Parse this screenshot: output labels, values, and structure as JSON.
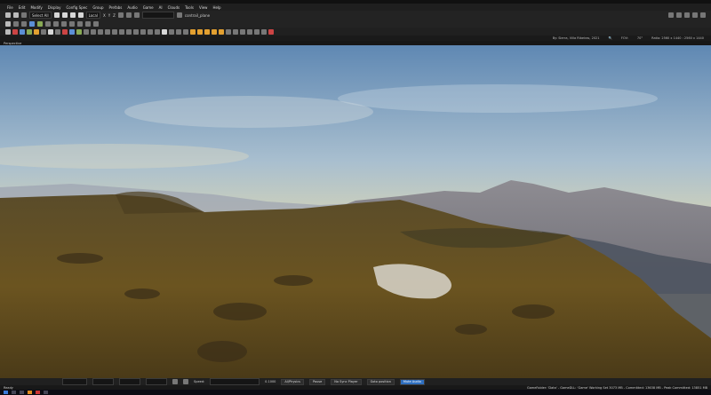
{
  "menu": [
    "File",
    "Edit",
    "Modify",
    "Display",
    "Config Spec",
    "Group",
    "Prefabs",
    "Audio",
    "Game",
    "AI",
    "Clouds",
    "Tools",
    "View",
    "Help"
  ],
  "toolbar": {
    "select_all": "Select All",
    "coord_space": "Local",
    "axis_x": "X",
    "axis_y": "Y",
    "axis_z": "Z",
    "object_name": "contrail_plane"
  },
  "infobar": {
    "location": "By: Sierra, Villa Ribeiras, 2021",
    "fov_label": "FOV:",
    "fov_value": "70°",
    "ratio": "Ratio: 2560 x 1440 : 2560 x 1440"
  },
  "viewport": {
    "mode_label": "Perspective"
  },
  "bottombar": {
    "speed_label": "Speed:",
    "speed_value": "0.1000",
    "ai_physics": "AI/Physics",
    "pause": "Pause",
    "no_sync_player": "No Sync Player",
    "goto_position": "Goto position",
    "mute_audio": "Mute Audio"
  },
  "status": {
    "left": "Ready",
    "right": "GameFolder: 'Data' - GameDLL: 'Game'   Working Set 3073 MB - Committed: 13638 MB - Peak Committed: 13851 MB"
  },
  "colors": {
    "sky_top": "#6f97bd",
    "sky_horizon": "#f0dca0",
    "terrain": "#5f4a1f",
    "accent": "#2f6fbf"
  }
}
